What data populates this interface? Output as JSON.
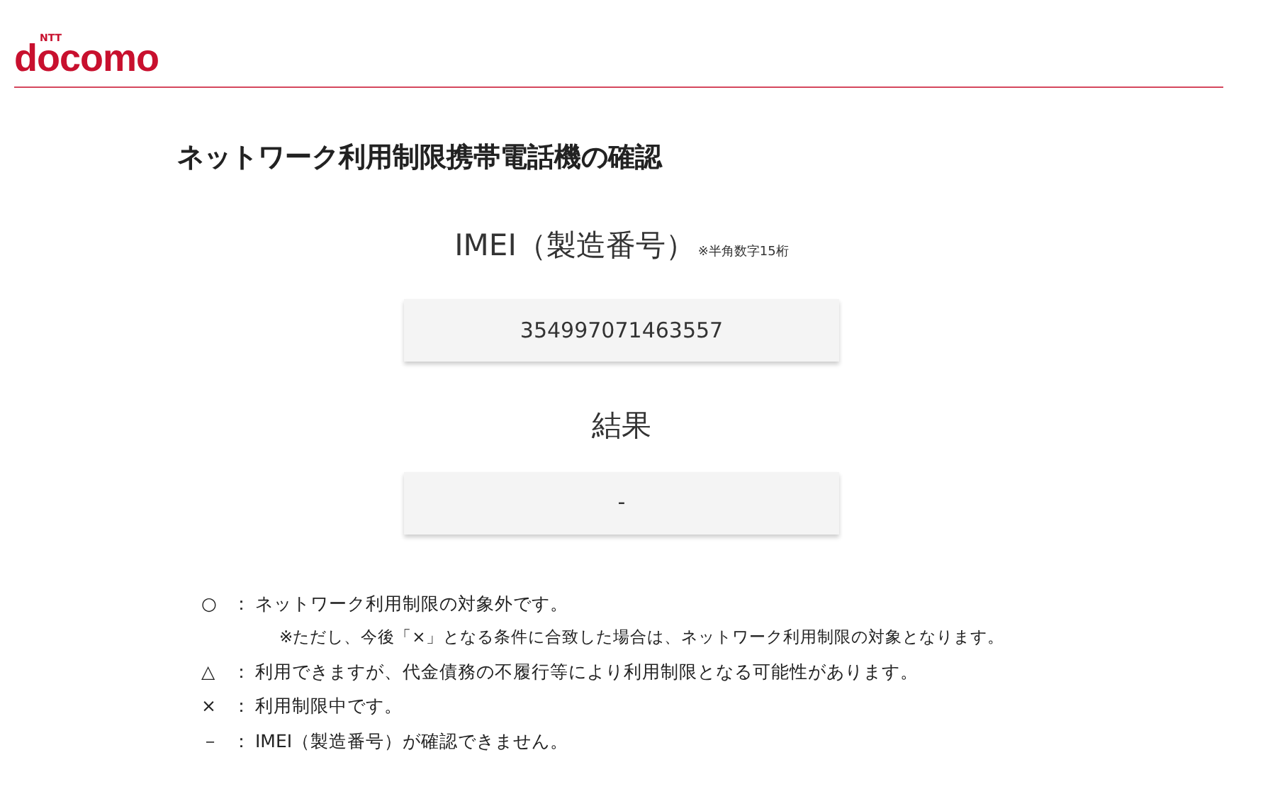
{
  "header": {
    "logo_small": "NTT",
    "logo": "docomo"
  },
  "title": "ネットワーク利用制限携帯電話機の確認",
  "imei": {
    "label": "IMEI（製造番号）",
    "note": "※半角数字15桁",
    "value": "354997071463557"
  },
  "result": {
    "label": "結果",
    "value": "-"
  },
  "legend": [
    {
      "symbol": "○",
      "separator": "：",
      "text": "ネットワーク利用制限の対象外です。",
      "note": "※ただし、今後「×」となる条件に合致した場合は、ネットワーク利用制限の対象となります。"
    },
    {
      "symbol": "△",
      "separator": "：",
      "text": "利用できますが、代金債務の不履行等により利用制限となる可能性があります。"
    },
    {
      "symbol": "×",
      "separator": "：",
      "text": "利用制限中です。"
    },
    {
      "symbol": "－",
      "separator": "：",
      "text": "IMEI（製造番号）が確認できません。"
    }
  ]
}
